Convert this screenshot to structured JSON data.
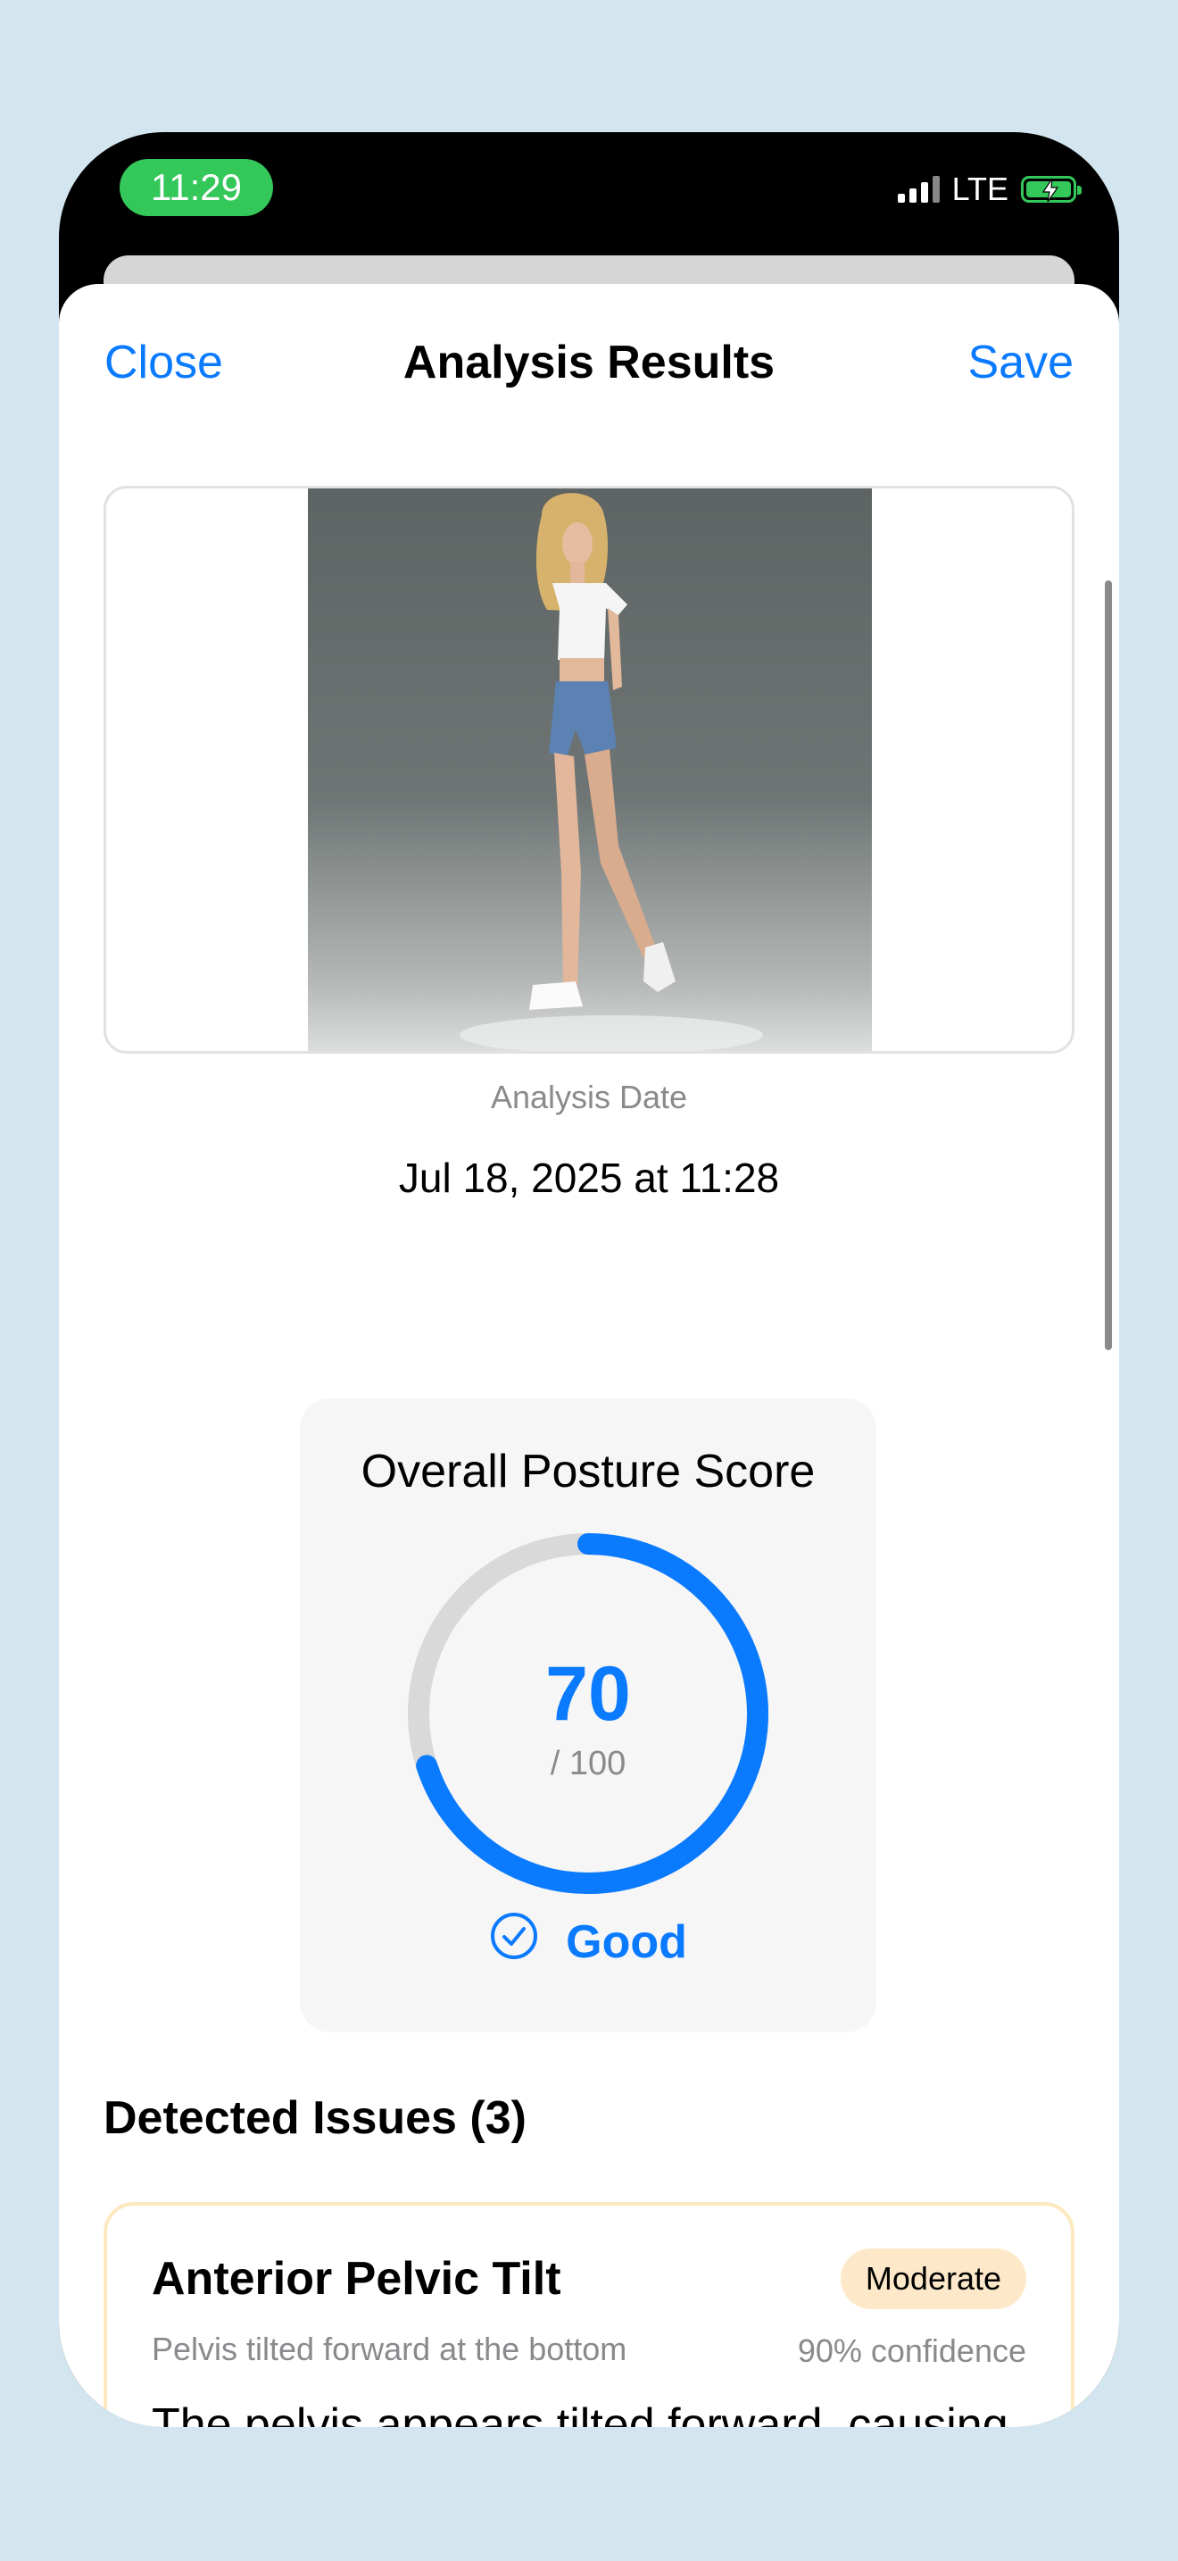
{
  "status_bar": {
    "time": "11:29",
    "network": "LTE",
    "battery_icon": "battery-charging-icon",
    "signal_icon": "cellular-signal-icon"
  },
  "nav": {
    "close_label": "Close",
    "title": "Analysis Results",
    "save_label": "Save"
  },
  "analysis": {
    "date_label": "Analysis Date",
    "date_value": "Jul 18, 2025 at 11:28"
  },
  "score": {
    "title": "Overall Posture Score",
    "value": "70",
    "max_label": "/ 100",
    "fraction": 0.7,
    "rating": "Good",
    "rating_icon": "checkmark-circle-icon",
    "color": "#0a7aff",
    "track_color": "#d9d9d9"
  },
  "issues": {
    "heading": "Detected Issues (3)",
    "items": [
      {
        "name": "Anterior Pelvic Tilt",
        "severity": "Moderate",
        "summary": "Pelvis tilted forward at the bottom",
        "confidence": "90% confidence",
        "detail": "The pelvis appears tilted forward, causing an exaggerated curve in the lower back."
      }
    ]
  }
}
